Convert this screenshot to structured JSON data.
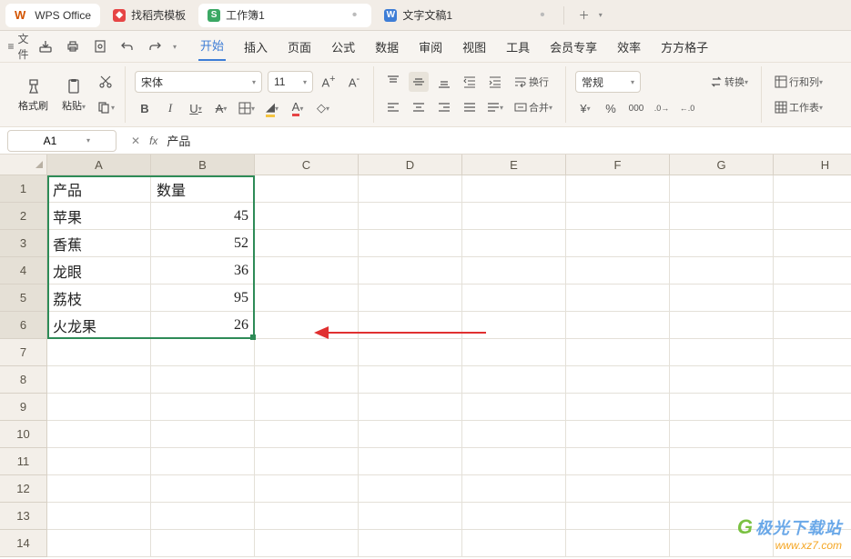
{
  "tabs": {
    "app_name": "WPS Office",
    "t1": "找稻壳模板",
    "t2": "工作簿1",
    "t3": "文字文稿1"
  },
  "menu": {
    "file": "文件",
    "items": [
      "开始",
      "插入",
      "页面",
      "公式",
      "数据",
      "审阅",
      "视图",
      "工具",
      "会员专享",
      "效率",
      "方方格子"
    ]
  },
  "ribbon": {
    "format_painter": "格式刷",
    "paste": "粘贴",
    "font_name": "宋体",
    "font_size": "11",
    "wrap": "换行",
    "merge": "合并",
    "number_format": "常规",
    "transform": "转换",
    "rowcol": "行和列",
    "worksheet": "工作表"
  },
  "formula": {
    "cell_ref": "A1",
    "value": "产品"
  },
  "grid": {
    "columns": [
      "A",
      "B",
      "C",
      "D",
      "E",
      "F",
      "G",
      "H"
    ],
    "rows": [
      "1",
      "2",
      "3",
      "4",
      "5",
      "6",
      "7",
      "8",
      "9",
      "10",
      "11",
      "12",
      "13",
      "14"
    ],
    "data": [
      {
        "a": "产品",
        "b": "数量"
      },
      {
        "a": "苹果",
        "b": "45"
      },
      {
        "a": "香蕉",
        "b": "52"
      },
      {
        "a": "龙眼",
        "b": "36"
      },
      {
        "a": "荔枝",
        "b": "95"
      },
      {
        "a": "火龙果",
        "b": "26"
      }
    ]
  },
  "watermark": {
    "line1": "极光下载站",
    "line2": "www.xz7.com"
  },
  "chart_data": {
    "type": "table",
    "columns": [
      "产品",
      "数量"
    ],
    "rows": [
      [
        "苹果",
        45
      ],
      [
        "香蕉",
        52
      ],
      [
        "龙眼",
        36
      ],
      [
        "荔枝",
        95
      ],
      [
        "火龙果",
        26
      ]
    ]
  }
}
